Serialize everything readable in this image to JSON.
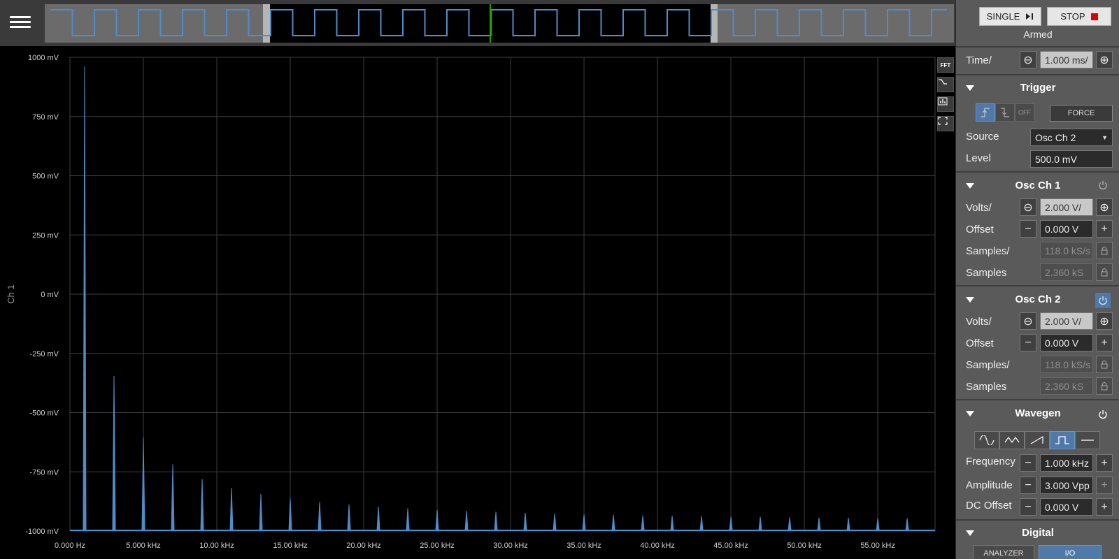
{
  "colors": {
    "accent": "#4e79a8",
    "trace": "#4f8dc9",
    "grid": "#3f3f3f",
    "center_marker": "#1fa000"
  },
  "header": {
    "menu_icon": "hamburger-icon"
  },
  "controls": {
    "single_label": "SINGLE",
    "stop_label": "STOP",
    "status": "Armed",
    "time_label": "Time/",
    "time_value": "1.000 ms/"
  },
  "trigger": {
    "title": "Trigger",
    "off_label": "OFF",
    "force_label": "FORCE",
    "source_label": "Source",
    "source_value": "Osc Ch 2",
    "level_label": "Level",
    "level_value": "500.0 mV"
  },
  "channels": [
    {
      "title": "Osc Ch 1",
      "enabled": false,
      "volts_label": "Volts/",
      "volts_value": "2.000 V/",
      "offset_label": "Offset",
      "offset_value": "0.000 V",
      "rate_label": "Samples/",
      "rate_value": "118.0 kS/s",
      "samples_label": "Samples",
      "samples_value": "2.360 kS"
    },
    {
      "title": "Osc Ch 2",
      "enabled": true,
      "volts_label": "Volts/",
      "volts_value": "2.000 V/",
      "offset_label": "Offset",
      "offset_value": "0.000 V",
      "rate_label": "Samples/",
      "rate_value": "118.0 kS/s",
      "samples_label": "Samples",
      "samples_value": "2.360 kS"
    }
  ],
  "wavegen": {
    "title": "Wavegen",
    "selected_shape": "square",
    "frequency_label": "Frequency",
    "frequency_value": "1.000 kHz",
    "amplitude_label": "Amplitude",
    "amplitude_value": "3.000 Vpp",
    "dc_offset_label": "DC Offset",
    "dc_offset_value": "0.000 V"
  },
  "digital": {
    "title": "Digital",
    "analyzer_label": "ANALYZER",
    "io_label": "I/O"
  },
  "tools": {
    "fft_label": "FFT"
  },
  "chart_data": {
    "type": "line",
    "channel_label": "Ch 1",
    "xlabel": "",
    "ylabel": "",
    "xlim": [
      0,
      58.9
    ],
    "ylim": [
      -1000,
      1000
    ],
    "y_ticks": [
      1000,
      750,
      500,
      250,
      0,
      -250,
      -500,
      -750,
      -1000
    ],
    "y_tick_labels": [
      "1000 mV",
      "750 mV",
      "500 mV",
      "250 mV",
      "0 mV",
      "-250 mV",
      "-500 mV",
      "-750 mV",
      "-1000 mV"
    ],
    "x_ticks": [
      0,
      5,
      10,
      15,
      20,
      25,
      30,
      35,
      40,
      45,
      50,
      55
    ],
    "x_tick_labels": [
      "0.000 Hz",
      "5.000 kHz",
      "10.00 kHz",
      "15.00 kHz",
      "20.00 kHz",
      "25.00 kHz",
      "30.00 kHz",
      "35.00 kHz",
      "40.00 kHz",
      "45.00 kHz",
      "50.00 kHz",
      "55.00 kHz"
    ],
    "grid": true,
    "series": [
      {
        "harmonics_khz": [
          1,
          3,
          5,
          7,
          9,
          11,
          13,
          15,
          17,
          19,
          21,
          23,
          25,
          27,
          29,
          31,
          33,
          35,
          37,
          39,
          41,
          43,
          45,
          47,
          49,
          51,
          53,
          55,
          57
        ],
        "peaks_mv": [
          960,
          -345,
          -605,
          -718,
          -780,
          -818,
          -843,
          -862,
          -877,
          -888,
          -897,
          -904,
          -910,
          -915,
          -919,
          -923,
          -926,
          -929,
          -931,
          -934,
          -936,
          -937,
          -939,
          -940,
          -942,
          -943,
          -944,
          -945,
          -946
        ]
      }
    ]
  }
}
